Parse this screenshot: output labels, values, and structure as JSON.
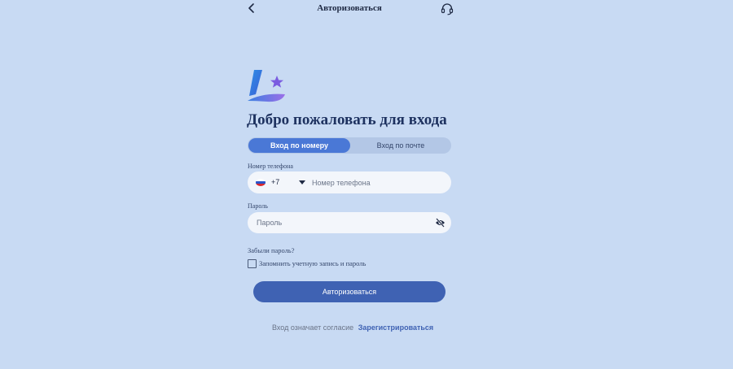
{
  "header": {
    "title": "Авторизоваться",
    "back_icon": "chevron-left-icon",
    "support_icon": "headset-icon"
  },
  "welcome_heading": "Добро пожаловать для входа",
  "tabs": [
    {
      "label": "Вход по номеру",
      "active": true
    },
    {
      "label": "Вход по почте",
      "active": false
    }
  ],
  "phone": {
    "label": "Номер телефона",
    "country_code": "+7",
    "placeholder": "Номер телефона",
    "value": ""
  },
  "password": {
    "label": "Пароль",
    "placeholder": "Пароль",
    "value": ""
  },
  "forgot_password": "Забыли пароль?",
  "remember": {
    "label": "Запомнить учетную запись и пароль",
    "checked": false
  },
  "submit_label": "Авторизоваться",
  "footer": {
    "text": "Вход означает согласие",
    "link": "Зарегистрироваться"
  },
  "colors": {
    "background": "#c8daf3",
    "accent": "#4a78d6",
    "button": "#3f62b3",
    "heading": "#1e3260"
  }
}
